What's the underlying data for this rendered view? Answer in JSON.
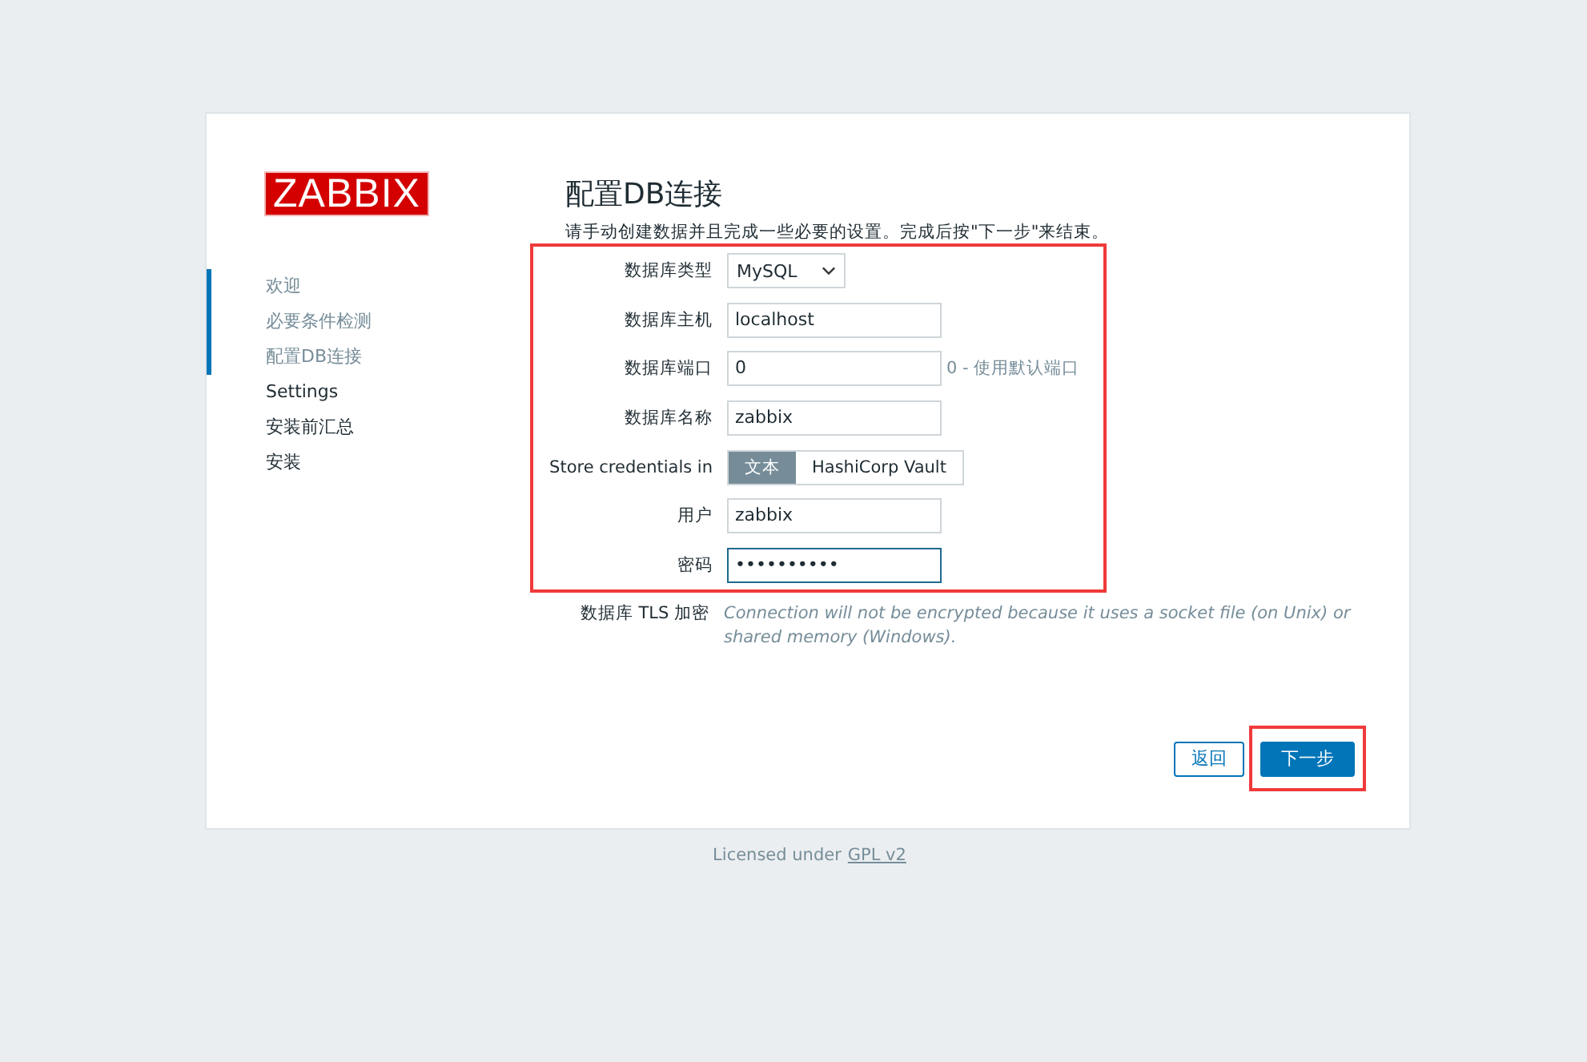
{
  "logo": {
    "text": "ZABBIX"
  },
  "sidebar": {
    "items": [
      {
        "label": "欢迎",
        "completed": true
      },
      {
        "label": "必要条件检测",
        "completed": true
      },
      {
        "label": "配置DB连接",
        "completed": true
      },
      {
        "label": "Settings",
        "completed": false
      },
      {
        "label": "安装前汇总",
        "completed": false
      },
      {
        "label": "安装",
        "completed": false
      }
    ]
  },
  "title": "配置DB连接",
  "subtitle": "请手动创建数据并且完成一些必要的设置。完成后按\"下一步\"来结束。",
  "form": {
    "highlighted": true,
    "rows": [
      {
        "kind": "select",
        "label": "数据库类型",
        "value": "MySQL"
      },
      {
        "kind": "input",
        "label": "数据库主机",
        "value": "localhost"
      },
      {
        "kind": "input",
        "label": "数据库端口",
        "value": "0",
        "hint": "0 - 使用默认端口"
      },
      {
        "kind": "input",
        "label": "数据库名称",
        "value": "zabbix"
      },
      {
        "kind": "toggle",
        "label": "Store credentials in",
        "options": [
          {
            "label": "文本",
            "selected": true
          },
          {
            "label": "HashiCorp Vault",
            "selected": false
          }
        ]
      },
      {
        "kind": "input",
        "label": "用户",
        "value": "zabbix"
      },
      {
        "kind": "password",
        "label": "密码",
        "value": "••••••••••",
        "focused": true
      }
    ]
  },
  "tls": {
    "label": "数据库 TLS 加密",
    "note": "Connection will not be encrypted because it uses a socket file (on Unix) or shared memory (Windows)."
  },
  "buttons": [
    {
      "label": "返回",
      "kind": "secondary",
      "highlighted": false
    },
    {
      "label": "下一步",
      "kind": "primary",
      "highlighted": true
    }
  ],
  "footer": {
    "text": "Licensed under",
    "link": "GPL v2"
  }
}
